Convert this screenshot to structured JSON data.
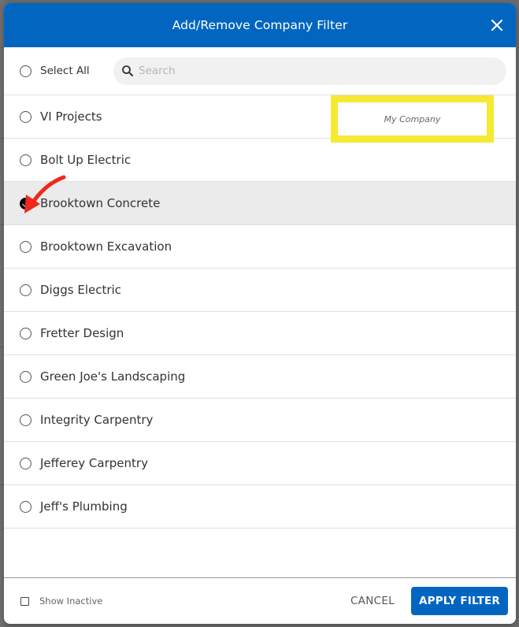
{
  "dialog": {
    "title": "Add/Remove Company Filter",
    "close_icon": "close-icon"
  },
  "toolbar": {
    "select_all_label": "Select All",
    "select_all_checked": false,
    "search_placeholder": "Search",
    "search_value": "",
    "search_icon": "search-icon"
  },
  "companies": [
    {
      "name": "VI Projects",
      "checked": false,
      "tag": "My Company"
    },
    {
      "name": "Bolt Up Electric",
      "checked": false
    },
    {
      "name": "Brooktown Concrete",
      "checked": true
    },
    {
      "name": "Brooktown Excavation",
      "checked": false
    },
    {
      "name": "Diggs Electric",
      "checked": false
    },
    {
      "name": "Fretter Design",
      "checked": false
    },
    {
      "name": "Green Joe's Landscaping",
      "checked": false
    },
    {
      "name": "Integrity Carpentry",
      "checked": false
    },
    {
      "name": "Jefferey Carpentry",
      "checked": false
    },
    {
      "name": "Jeff's Plumbing",
      "checked": false
    }
  ],
  "footer": {
    "show_inactive_label": "Show Inactive",
    "show_inactive_checked": false,
    "cancel_label": "CANCEL",
    "apply_label": "APPLY FILTER"
  },
  "colors": {
    "brand": "#0266c1",
    "highlight": "#f5e934",
    "annotation": "#f0281e",
    "selected_row": "#ebebeb"
  }
}
